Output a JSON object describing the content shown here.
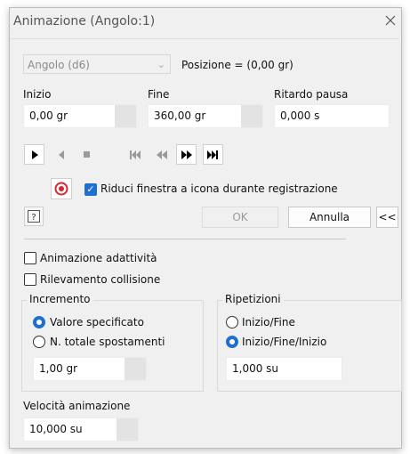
{
  "dialog": {
    "title": "Animazione (Angolo:1)",
    "close_icon": "close-icon"
  },
  "top": {
    "combo_value": "Angolo (d6)",
    "position_label": "Posizione = (0,00 gr)"
  },
  "fields": {
    "start_label": "Inizio",
    "start_value": "0,00 gr",
    "end_label": "Fine",
    "end_value": "360,00 gr",
    "pause_label": "Ritardo pausa",
    "pause_value": "0,000 s"
  },
  "playback": {
    "icons": [
      "play-forward-icon",
      "play-reverse-icon",
      "stop-icon",
      "go-to-start-icon",
      "step-back-icon",
      "step-forward-icon",
      "go-to-end-icon"
    ]
  },
  "record": {
    "icon": "record-icon",
    "checkbox_label": "Riduci finestra a icona durante registrazione",
    "checked": true
  },
  "buttons": {
    "help_icon": "help-icon",
    "ok": "OK",
    "cancel": "Annulla",
    "collapse": "<<"
  },
  "options": {
    "adaptivity": "Animazione adattività",
    "collision": "Rilevamento collisione"
  },
  "increment": {
    "title": "Incremento",
    "option1": "Valore specificato",
    "option2": "N. totale spostamenti",
    "value": "1,00 gr"
  },
  "repetitions": {
    "title": "Ripetizioni",
    "option1": "Inizio/Fine",
    "option2": "Inizio/Fine/Inizio",
    "value": "1,000 su"
  },
  "speed": {
    "label": "Velocità animazione",
    "value": "10,000 su"
  },
  "colors": {
    "accent": "#1f6fd1",
    "record": "#d9262f"
  }
}
